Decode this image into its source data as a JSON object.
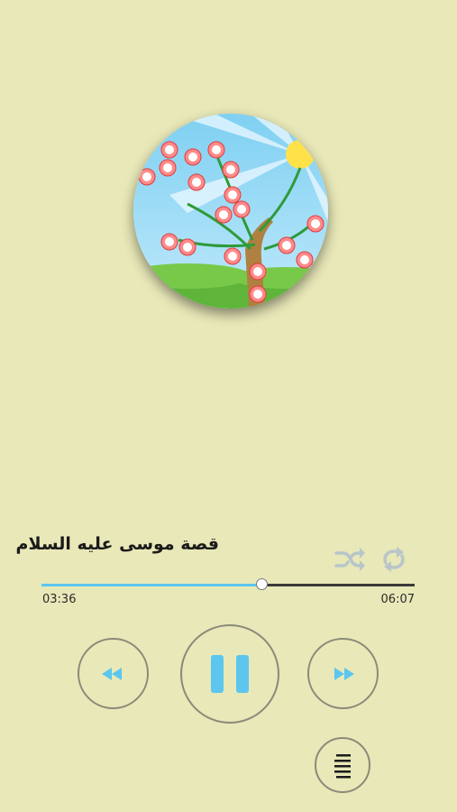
{
  "player": {
    "track_title": "قصة موسى عليه السلام",
    "current_time": "03:36",
    "duration": "06:07",
    "progress": 0.589
  },
  "colors": {
    "background": "#e8e8b8",
    "accent": "#5cc6ee",
    "icon_inactive": "#b8c6ca"
  },
  "icons": {
    "shuffle": "shuffle-icon",
    "repeat": "repeat-icon",
    "rewind": "rewind-icon",
    "pause": "pause-icon",
    "forward": "fast-forward-icon",
    "playlist": "playlist-icon"
  }
}
